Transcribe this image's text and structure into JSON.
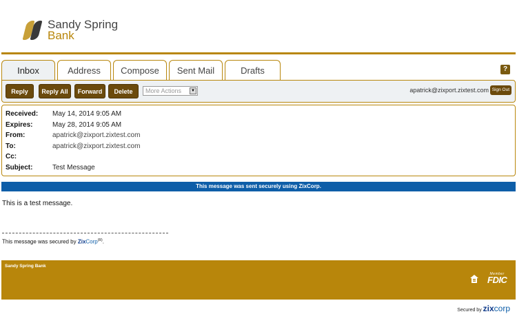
{
  "brand": {
    "line1": "Sandy Spring",
    "line2": "Bank",
    "gold": "#b8860b",
    "dark_brown": "#6b4a0c",
    "blue": "#0e5ea8"
  },
  "tabs": [
    {
      "label": "Inbox",
      "active": true
    },
    {
      "label": "Address",
      "active": false
    },
    {
      "label": "Compose",
      "active": false
    },
    {
      "label": "Sent Mail",
      "active": false
    },
    {
      "label": "Drafts",
      "active": false
    }
  ],
  "help": {
    "label": "?",
    "icon": "help-icon"
  },
  "toolbar": {
    "reply_label": "Reply",
    "reply_all_label": "Reply All",
    "forward_label": "Forward",
    "delete_label": "Delete",
    "more_actions_value": "More Actions",
    "more_actions_icon": "dropdown-arrow-icon",
    "user_email": "apatrick@zixport.zixtest.com",
    "sign_out_label": "Sign Out"
  },
  "message": {
    "received_label": "Received:",
    "received_value": "May 14, 2014 9:05 AM",
    "expires_label": "Expires:",
    "expires_value": "May 28, 2014 9:05 AM",
    "from_label": "From:",
    "from_value": "apatrick@zixport.zixtest.com",
    "to_label": "To:",
    "to_value": "apatrick@zixport.zixtest.com",
    "cc_label": "Cc:",
    "cc_value": "",
    "subject_label": "Subject:",
    "subject_value": "Test Message",
    "body": "This is a test message."
  },
  "secure_banner": {
    "text": "This message was sent securely using ",
    "zix": "Zix",
    "corp": "Corp",
    "end": "."
  },
  "footer_note": {
    "text": "This message was secured by ",
    "zix": "Zix",
    "corp": "Corp",
    "reg": "(R)",
    "end": "."
  },
  "footer": {
    "bank_name": "Sandy Spring Bank",
    "housing_icon": "equal-housing-lender-icon",
    "fdic_member": "Member",
    "fdic": "FDIC"
  },
  "secured_by": {
    "label": "Secured by ",
    "zix": "zix",
    "corp": "corp"
  }
}
